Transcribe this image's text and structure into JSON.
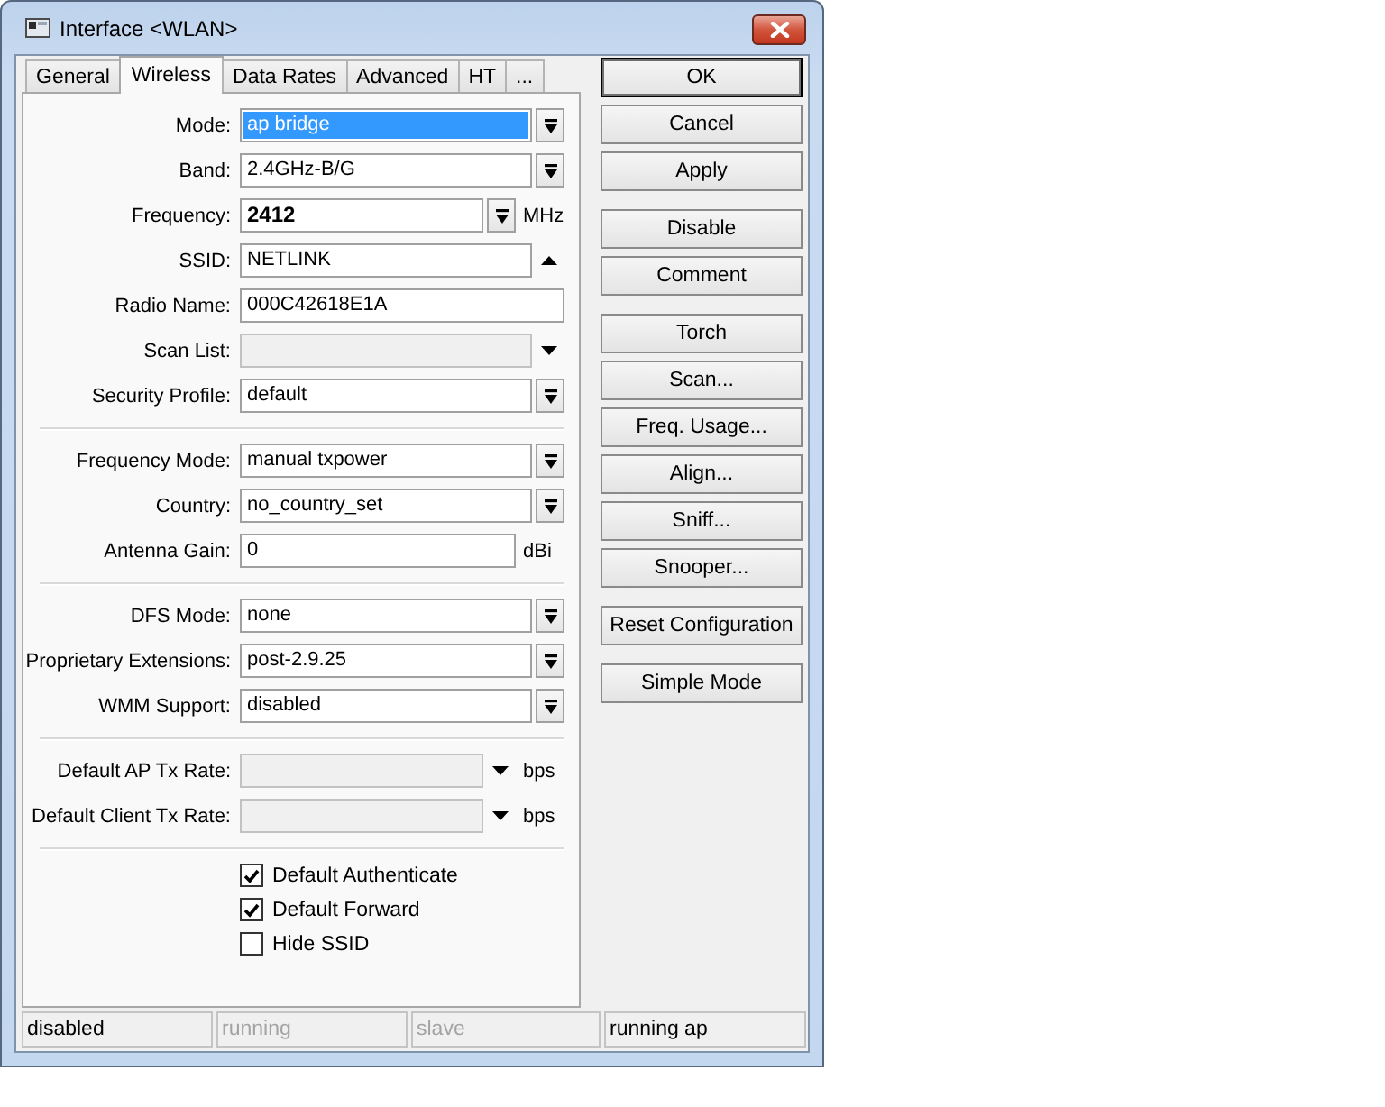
{
  "window": {
    "title": "Interface <WLAN>"
  },
  "tabs": [
    {
      "label": "General",
      "selected": false
    },
    {
      "label": "Wireless",
      "selected": true
    },
    {
      "label": "Data Rates",
      "selected": false
    },
    {
      "label": "Advanced",
      "selected": false
    },
    {
      "label": "HT",
      "selected": false
    },
    {
      "label": "...",
      "selected": false
    }
  ],
  "form": {
    "groups": [
      {
        "rows": [
          {
            "label": "Mode:",
            "kind": "select",
            "value": "ap bridge",
            "highlighted": true,
            "bold": false,
            "disabled": false
          },
          {
            "label": "Band:",
            "kind": "select",
            "value": "2.4GHz-B/G",
            "highlighted": false,
            "bold": false,
            "disabled": false
          },
          {
            "label": "Frequency:",
            "kind": "select",
            "value": "2412",
            "unit": "MHz",
            "highlighted": false,
            "bold": true,
            "disabled": false
          },
          {
            "label": "SSID:",
            "kind": "collapse",
            "value": "NETLINK",
            "highlighted": false,
            "bold": false,
            "disabled": false
          },
          {
            "label": "Radio Name:",
            "kind": "text",
            "value": "000C42618E1A",
            "highlighted": false,
            "bold": false,
            "disabled": false
          },
          {
            "label": "Scan List:",
            "kind": "expand",
            "highlighted": false,
            "disabled": true
          },
          {
            "label": "Security Profile:",
            "kind": "select",
            "value": "default",
            "highlighted": false,
            "bold": false,
            "disabled": false
          }
        ]
      },
      {
        "rows": [
          {
            "label": "Frequency Mode:",
            "kind": "select",
            "value": "manual txpower",
            "highlighted": false,
            "bold": false,
            "disabled": false
          },
          {
            "label": "Country:",
            "kind": "select",
            "value": "no_country_set",
            "highlighted": false,
            "bold": false,
            "disabled": false
          },
          {
            "label": "Antenna Gain:",
            "kind": "text",
            "value": "0",
            "unit": "dBi",
            "highlighted": false,
            "bold": false,
            "disabled": false
          }
        ]
      },
      {
        "rows": [
          {
            "label": "DFS Mode:",
            "kind": "select",
            "value": "none",
            "highlighted": false,
            "bold": false,
            "disabled": false
          },
          {
            "label": "Proprietary Extensions:",
            "kind": "select",
            "value": "post-2.9.25",
            "highlighted": false,
            "bold": false,
            "disabled": false
          },
          {
            "label": "WMM Support:",
            "kind": "select",
            "value": "disabled",
            "highlighted": false,
            "bold": false,
            "disabled": false
          }
        ]
      },
      {
        "rows": [
          {
            "label": "Default AP Tx Rate:",
            "kind": "expand",
            "unit": "bps",
            "highlighted": false,
            "disabled": true
          },
          {
            "label": "Default Client Tx Rate:",
            "kind": "expand",
            "unit": "bps",
            "highlighted": false,
            "disabled": true
          }
        ]
      }
    ],
    "checkboxes": [
      {
        "label": "Default Authenticate",
        "checked": true
      },
      {
        "label": "Default Forward",
        "checked": true
      },
      {
        "label": "Hide SSID",
        "checked": false
      }
    ]
  },
  "button_groups": [
    {
      "buttons": [
        {
          "label": "OK",
          "default": true
        },
        {
          "label": "Cancel",
          "default": false
        },
        {
          "label": "Apply",
          "default": false
        }
      ]
    },
    {
      "buttons": [
        {
          "label": "Disable",
          "default": false
        },
        {
          "label": "Comment",
          "default": false
        }
      ]
    },
    {
      "buttons": [
        {
          "label": "Torch",
          "default": false
        },
        {
          "label": "Scan...",
          "default": false
        },
        {
          "label": "Freq. Usage...",
          "default": false
        },
        {
          "label": "Align...",
          "default": false
        },
        {
          "label": "Sniff...",
          "default": false
        },
        {
          "label": "Snooper...",
          "default": false
        }
      ]
    },
    {
      "buttons": [
        {
          "label": "Reset Configuration",
          "default": false
        }
      ]
    },
    {
      "buttons": [
        {
          "label": "Simple Mode",
          "default": false
        }
      ]
    }
  ],
  "status_bar": [
    {
      "text": "disabled",
      "greyed": false
    },
    {
      "text": "running",
      "greyed": true
    },
    {
      "text": "slave",
      "greyed": true
    },
    {
      "text": "running ap",
      "greyed": false
    }
  ]
}
